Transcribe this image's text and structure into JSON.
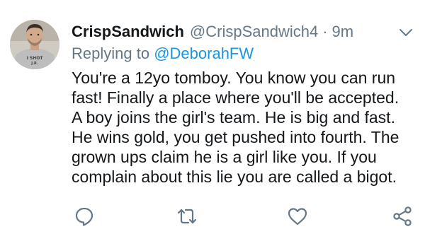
{
  "tweet": {
    "display_name": "CrispSandwich",
    "handle": "@CrispSandwich4",
    "separator": "·",
    "time": "9m",
    "replying_prefix": "Replying to",
    "replying_to": "@DeborahFW",
    "body_lines": [
      "You're a 12yo tomboy. You know you can run",
      "fast! Finally a place where you'll be accepted.",
      "A boy joins the girl's team. He is big and fast.",
      "He wins gold, you get pushed into fourth. The",
      "grown ups claim he is a girl like you. If you",
      "complain about this lie you are called a bigot."
    ],
    "avatar_shirt_text": [
      "I SHOT",
      "J.R."
    ]
  },
  "icons": {
    "more": "chevron-down-icon",
    "reply": "reply-icon",
    "retweet": "retweet-icon",
    "like": "heart-icon",
    "share": "share-icon"
  },
  "colors": {
    "text": "#14171a",
    "secondary": "#657786",
    "link": "#1b95e0"
  }
}
